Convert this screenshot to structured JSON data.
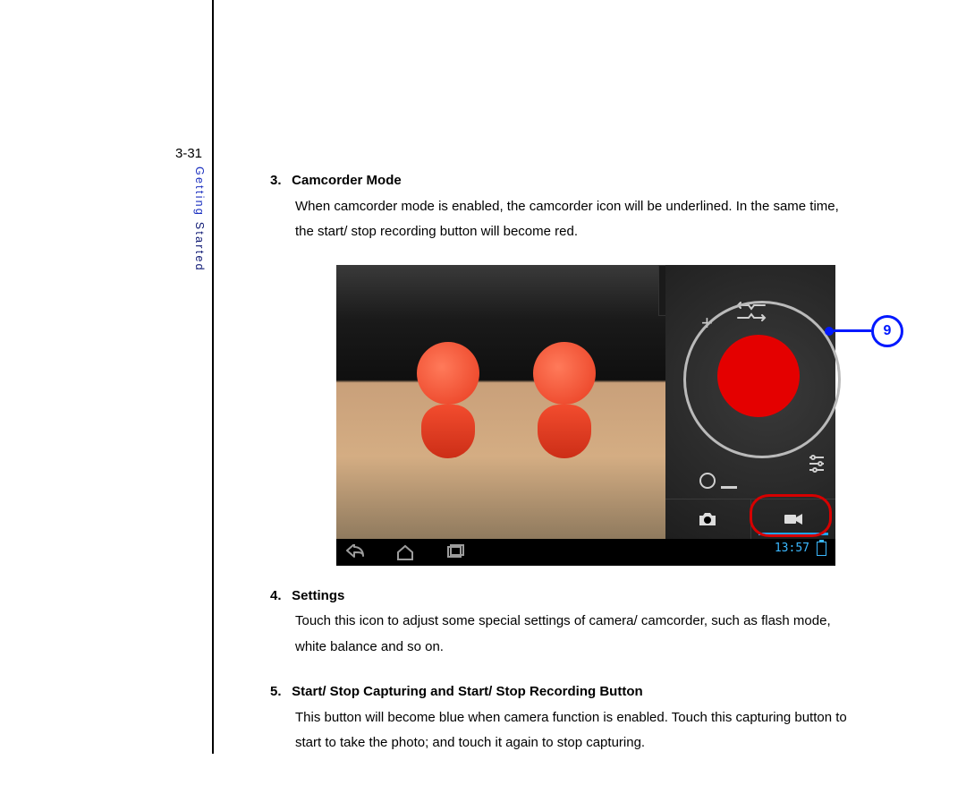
{
  "page_number": "3-31",
  "side_label_part1": "Getting",
  "side_label_part2": "Started",
  "sections": [
    {
      "num": "3.",
      "title": "Camcorder Mode",
      "body": "When camcorder mode is enabled, the camcorder icon will be underlined. In the same time, the start/ stop recording button will become red."
    },
    {
      "num": "4.",
      "title": "Settings",
      "body": "Touch this icon to adjust some special settings of camera/ camcorder, such as flash mode, white balance and so on."
    },
    {
      "num": "5.",
      "title": "Start/ Stop Capturing and Start/ Stop Recording Button",
      "body": "This button will become blue when camera function is enabled. Touch this capturing button to start to take the photo; and touch it again to stop capturing."
    }
  ],
  "screenshot": {
    "clock": "13:57",
    "callout_number": "9",
    "icons": {
      "zoom_in": "+",
      "switch_camera": "switch-camera-icon",
      "zoom_out_o": "O",
      "zoom_out_minus": "−",
      "sliders": "sliders-icon",
      "camera_mode": "camera-icon",
      "video_mode": "video-icon",
      "nav_back": "back-icon",
      "nav_home": "home-icon",
      "nav_recent": "recent-icon",
      "battery": "battery-icon"
    }
  }
}
